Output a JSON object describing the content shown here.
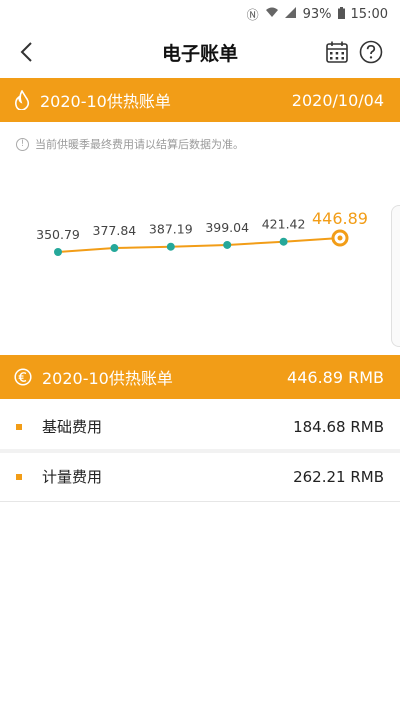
{
  "status_bar": {
    "battery": "93%",
    "time": "15:00"
  },
  "nav": {
    "title": "电子账单"
  },
  "bill_header": {
    "title": "2020-10供热账单",
    "date": "2020/10/04"
  },
  "notice": "当前供暖季最终费用请以结算后数据为准。",
  "chart_data": {
    "type": "line",
    "values": [
      350.79,
      377.84,
      387.19,
      399.04,
      421.42,
      446.89
    ],
    "labels": [
      "350.79",
      "377.84",
      "387.19",
      "399.04",
      "421.42",
      "446.89"
    ],
    "highlight_index": 5,
    "line_color": "#f29d17",
    "point_color": "#25a89a"
  },
  "summary": {
    "title": "2020-10供热账单",
    "total": "446.89 RMB"
  },
  "fees": [
    {
      "label": "基础费用",
      "amount": "184.68 RMB"
    },
    {
      "label": "计量费用",
      "amount": "262.21 RMB"
    }
  ],
  "colors": {
    "accent": "#f29d17",
    "teal": "#25a89a"
  }
}
